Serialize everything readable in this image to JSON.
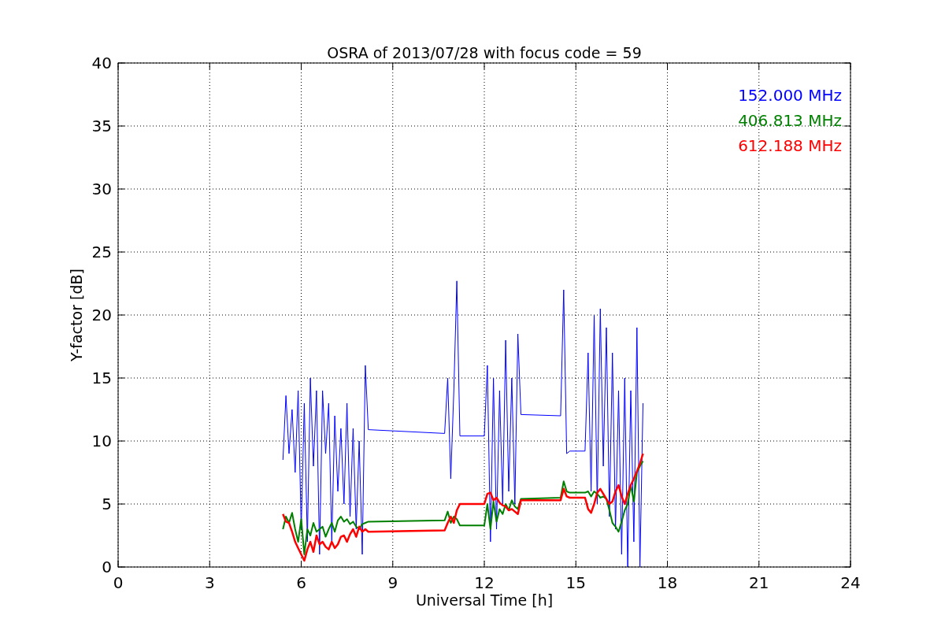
{
  "figure": {
    "chart_data": {
      "type": "line",
      "title": "OSRA of 2013/07/28 with focus code = 59",
      "xlabel": "Universal Time [h]",
      "ylabel": "Y-factor [dB]",
      "grid": true,
      "xlim": [
        0,
        24
      ],
      "ylim": [
        0,
        40
      ],
      "xticks": [
        {
          "value": 0,
          "label": "0"
        },
        {
          "value": 3,
          "label": "3"
        },
        {
          "value": 6,
          "label": "6"
        },
        {
          "value": 9,
          "label": "9"
        },
        {
          "value": 12,
          "label": "12"
        },
        {
          "value": 15,
          "label": "15"
        },
        {
          "value": 18,
          "label": "18"
        },
        {
          "value": 21,
          "label": "21"
        },
        {
          "value": 24,
          "label": "24"
        }
      ],
      "yticks": [
        {
          "value": 0,
          "label": "0"
        },
        {
          "value": 5,
          "label": "5"
        },
        {
          "value": 10,
          "label": "10"
        },
        {
          "value": 15,
          "label": "15"
        },
        {
          "value": 20,
          "label": "20"
        },
        {
          "value": 25,
          "label": "25"
        },
        {
          "value": 30,
          "label": "30"
        },
        {
          "value": 35,
          "label": "35"
        },
        {
          "value": 40,
          "label": "40"
        }
      ],
      "x": [
        5.4,
        5.5,
        5.6,
        5.7,
        5.8,
        5.9,
        6.0,
        6.1,
        6.2,
        6.3,
        6.4,
        6.5,
        6.6,
        6.7,
        6.8,
        6.9,
        7.0,
        7.1,
        7.2,
        7.3,
        7.4,
        7.5,
        7.6,
        7.7,
        7.8,
        7.9,
        8.0,
        8.1,
        8.2,
        10.7,
        10.8,
        10.9,
        11.0,
        11.1,
        11.2,
        12.0,
        12.1,
        12.2,
        12.3,
        12.4,
        12.5,
        12.6,
        12.7,
        12.8,
        12.9,
        13.0,
        13.1,
        13.2,
        14.5,
        14.6,
        14.7,
        14.8,
        15.3,
        15.4,
        15.5,
        15.6,
        15.7,
        15.8,
        15.9,
        16.0,
        16.1,
        16.2,
        16.3,
        16.4,
        16.5,
        16.6,
        16.7,
        16.8,
        16.9,
        17.0,
        17.1,
        17.2
      ],
      "series": [
        {
          "name": "152.000 MHz",
          "color": "#0000ff",
          "values": [
            8.5,
            13.6,
            9,
            12.5,
            7.5,
            14,
            3,
            13,
            2,
            15,
            8,
            14,
            1,
            14,
            9,
            13,
            2,
            12,
            6,
            11,
            5,
            13,
            4,
            11,
            3,
            10,
            1,
            16,
            10.9,
            10.6,
            15,
            7,
            14,
            22.7,
            10.4,
            10.4,
            16,
            2,
            15,
            3,
            14,
            5,
            18,
            6,
            15,
            5,
            18.5,
            12.1,
            12,
            22,
            9,
            9.2,
            9.2,
            17,
            6,
            20,
            5,
            20.5,
            8,
            19,
            4,
            17,
            3,
            14,
            1,
            15,
            0,
            14,
            2,
            19,
            0,
            13
          ]
        },
        {
          "name": "406.813 MHz",
          "color": "#008000",
          "values": [
            3,
            4,
            3.5,
            4.3,
            3,
            2,
            3.8,
            1,
            3,
            2.5,
            3.5,
            2.8,
            3,
            3.2,
            2.4,
            3,
            3.5,
            2.8,
            3.7,
            4,
            3.6,
            3.8,
            3.4,
            3.6,
            3.2,
            3,
            3.4,
            3.5,
            3.6,
            3.7,
            4.4,
            3.5,
            4,
            3.8,
            3.3,
            3.3,
            5,
            3,
            5.2,
            3.6,
            4.6,
            4.2,
            5,
            4.5,
            5.3,
            4.8,
            4.6,
            5.4,
            5.5,
            6.8,
            6,
            5.9,
            5.9,
            6,
            5.6,
            6,
            5.8,
            5.5,
            5.6,
            5.4,
            4.5,
            3.5,
            3.2,
            2.8,
            3.6,
            4.5,
            5,
            6.5,
            5.2,
            7.5,
            8,
            8.4
          ]
        },
        {
          "name": "612.188 MHz",
          "color": "#ff0000",
          "values": [
            4.2,
            3.6,
            3.5,
            2.8,
            2,
            1.5,
            1,
            0.5,
            1.4,
            2,
            1.2,
            2.5,
            1.8,
            2,
            1.6,
            1.4,
            2,
            1.5,
            1.8,
            2.4,
            2.5,
            2,
            2.6,
            3,
            2.4,
            3.2,
            2.8,
            3,
            2.8,
            2.9,
            3.5,
            4,
            3.5,
            4.5,
            5,
            5,
            5.8,
            5.9,
            5.3,
            5.5,
            5.1,
            4.9,
            4.8,
            4.5,
            4.6,
            4.4,
            4.2,
            5.3,
            5.3,
            6.2,
            5.6,
            5.5,
            5.5,
            4.6,
            4.3,
            5,
            5.9,
            6.2,
            5.8,
            5.4,
            5,
            5.2,
            6,
            6.5,
            5.6,
            5,
            5.8,
            6.5,
            7,
            7.6,
            8.2,
            9
          ]
        }
      ]
    }
  }
}
